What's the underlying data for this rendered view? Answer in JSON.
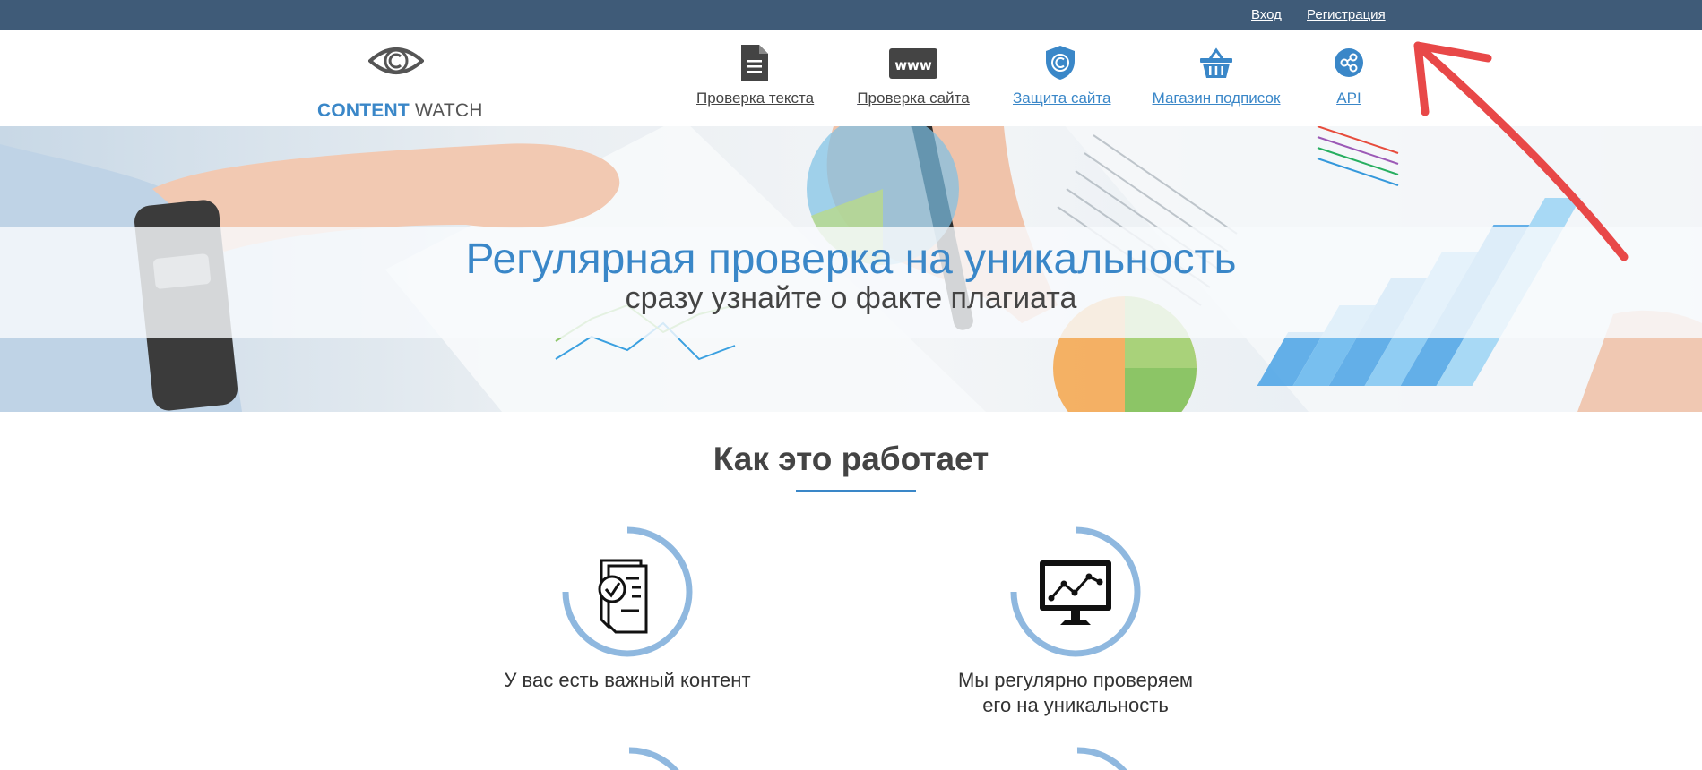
{
  "topbar": {
    "login": "Вход",
    "register": "Регистрация"
  },
  "logo": {
    "word1": "CONTENT",
    "word2": "WATCH"
  },
  "nav": [
    {
      "label": "Проверка текста",
      "icon": "document-icon"
    },
    {
      "label": "Проверка сайта",
      "icon": "www-icon"
    },
    {
      "label": "Защита сайта",
      "icon": "shield-copyright-icon"
    },
    {
      "label": "Магазин подписок",
      "icon": "basket-icon"
    },
    {
      "label": "API",
      "icon": "share-icon"
    }
  ],
  "hero": {
    "title": "Регулярная проверка на уникальность",
    "subtitle": "сразу узнайте о факте плагиата"
  },
  "how": {
    "title": "Как это работает",
    "steps": [
      {
        "text": "У вас есть важный контент",
        "icon": "document-check-icon"
      },
      {
        "line1": "Мы регулярно проверяем",
        "line2": "его на уникальность",
        "icon": "monitor-chart-icon"
      }
    ]
  },
  "colors": {
    "accent": "#3a87c8",
    "topbar": "#3f5b78",
    "ring": "#8fb8df",
    "arrow": "#e84848"
  }
}
